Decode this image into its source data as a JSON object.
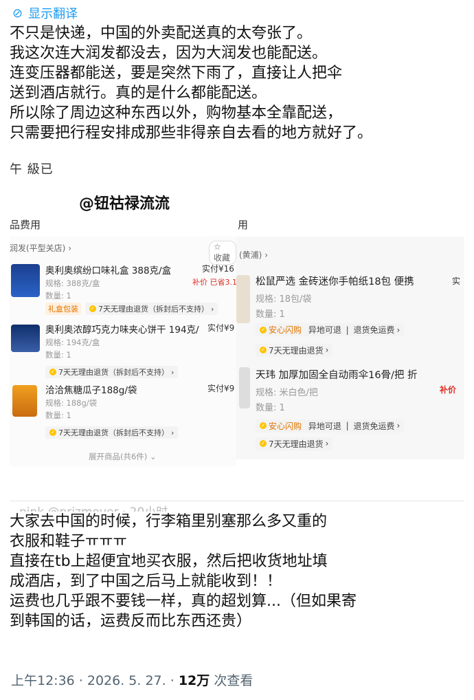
{
  "translate": {
    "icon": "globe-icon",
    "label": "显示翻译"
  },
  "caption_top": [
    "不只是快递，中国的外卖配送真的太夸张了。",
    "我这次连大润发都没去，因为大润发也能配送。",
    "连变压器都能送，要是突然下雨了，直接让人把伞",
    "送到酒店就行。真的是什么都能配送。",
    "所以除了周边这种东西以外，购物基本全靠配送，",
    "只需要把行程安排成那些非得亲自去看的地方就好了。"
  ],
  "overlap_text": "午 級已",
  "author": "@钮祜禄流流",
  "left_card": {
    "header": "品费用",
    "store": "润发(平型关店)",
    "collect": "收藏",
    "items": [
      {
        "title": "奥利奥缤纷口味礼盒 388克/盒",
        "spec": "规格: 388克/盒",
        "qty": "数量: 1",
        "price_label": "实付¥16",
        "sub_price": "补价 已省3.1",
        "tags": [
          "礼盒包装",
          "7天无理由退货（拆封后不支持）"
        ]
      },
      {
        "title": "奥利奥浓醇巧克力味夹心饼干 194克/",
        "spec": "规格: 194克/盒",
        "qty": "数量: 1",
        "price_label": "实付¥9",
        "tags": [
          "7天无理由退货（拆封后不支持）"
        ]
      },
      {
        "title": "洽洽焦糖瓜子188g/袋",
        "spec": "规格: 188g/袋",
        "qty": "数量: 1",
        "price_label": "实付¥9",
        "tags": [
          "7天无理由退货（拆封后不支持）"
        ]
      }
    ],
    "expand": "展开商品(共6件)"
  },
  "right_card": {
    "header": "用",
    "store": "(黄浦)",
    "items": [
      {
        "title": "松鼠严选 金砖迷你手帕纸18包 便携",
        "spec": "规格: 18包/袋",
        "qty": "数量: 1",
        "price_label": "实",
        "tags": [
          "安心闪购",
          "异地可退",
          "退货免运费",
          "7天无理由退货"
        ]
      },
      {
        "title": "天玮 加厚加固全自动雨伞16骨/把 折",
        "spec": "规格: 米白色/把",
        "qty": "数量: 1",
        "price_label": "补价",
        "tags": [
          "安心闪购",
          "异地可退",
          "退货免运费",
          "7天无理由退货"
        ]
      }
    ]
  },
  "ghost_tweet": "pink @prizmover · 20小时",
  "caption_bottom": [
    "大家去中国的时候，行李箱里别塞那么多又重的",
    "衣服和鞋子ㅠㅠㅠ",
    "直接在tb上超便宜地买衣服，然后把收货地址填",
    "成酒店，到了中国之后马上就能收到！！",
    "运费也几乎跟不要钱一样，真的超划算...（但如果寄",
    "到韩国的话，运费反而比东西还贵）"
  ],
  "footer": {
    "time": "上午12:36 · 2026. 5. 27. ·",
    "views_num": "12万",
    "views_label": "次查看"
  }
}
